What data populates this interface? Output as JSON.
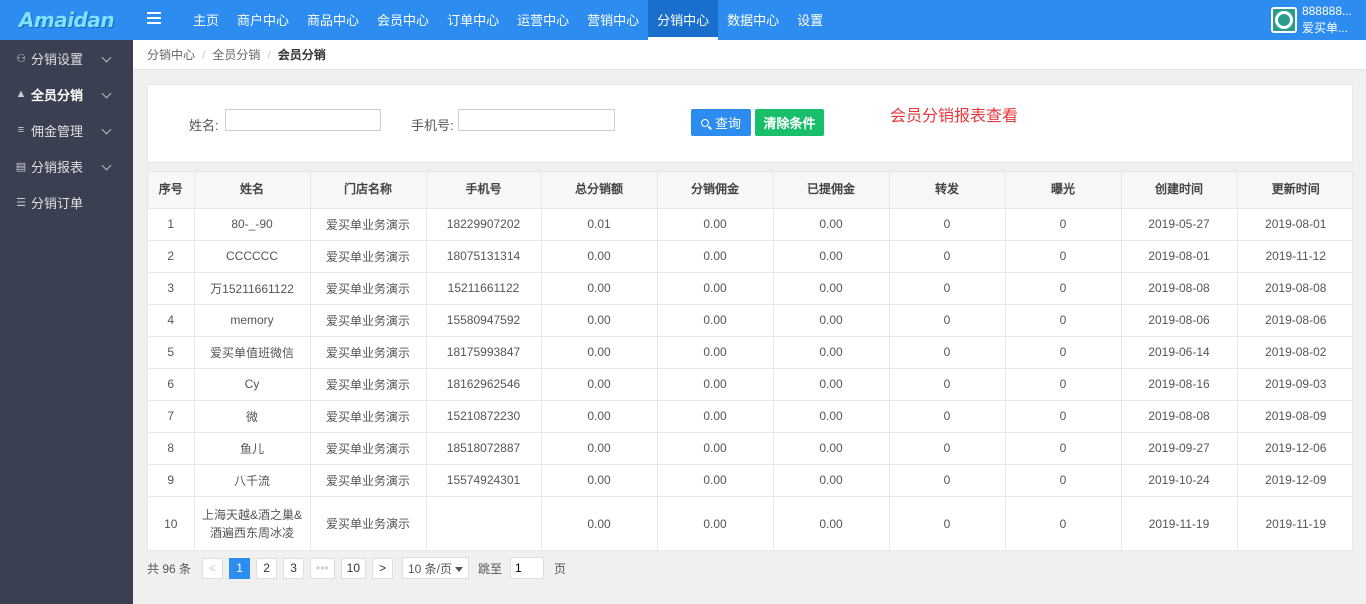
{
  "logo": "Amaidan",
  "nav": [
    "主页",
    "商户中心",
    "商品中心",
    "会员中心",
    "订单中心",
    "运营中心",
    "营销中心",
    "分销中心",
    "数据中心",
    "设置"
  ],
  "nav_active": 7,
  "user": {
    "line1": "888888...",
    "line2": "爱买单..."
  },
  "sidebar": [
    {
      "label": "分销设置",
      "icon": "users-icon",
      "caret": true
    },
    {
      "label": "全员分销",
      "icon": "user-icon",
      "caret": true,
      "active": true
    },
    {
      "label": "佣金管理",
      "icon": "database-icon",
      "caret": true
    },
    {
      "label": "分销报表",
      "icon": "report-icon",
      "caret": true
    },
    {
      "label": "分销订单",
      "icon": "list-icon",
      "caret": false
    }
  ],
  "breadcrumb": [
    "分销中心",
    "全员分销",
    "会员分销"
  ],
  "search": {
    "name_label": "姓名:",
    "name_value": "",
    "phone_label": "手机号:",
    "phone_value": "",
    "query_button": "查询",
    "clear_button": "清除条件",
    "report_title": "会员分销报表查看"
  },
  "table": {
    "headers": [
      "序号",
      "姓名",
      "门店名称",
      "手机号",
      "总分销额",
      "分销佣金",
      "已提佣金",
      "转发",
      "曝光",
      "创建时间",
      "更新时间"
    ],
    "rows": [
      [
        "1",
        "80-_-90",
        "爱买单业务演示",
        "18229907202",
        "0.01",
        "0.00",
        "0.00",
        "0",
        "0",
        "2019-05-27",
        "2019-08-01"
      ],
      [
        "2",
        "CCCCCC",
        "爱买单业务演示",
        "18075131314",
        "0.00",
        "0.00",
        "0.00",
        "0",
        "0",
        "2019-08-01",
        "2019-11-12"
      ],
      [
        "3",
        "万15211661122",
        "爱买单业务演示",
        "15211661122",
        "0.00",
        "0.00",
        "0.00",
        "0",
        "0",
        "2019-08-08",
        "2019-08-08"
      ],
      [
        "4",
        "memory",
        "爱买单业务演示",
        "15580947592",
        "0.00",
        "0.00",
        "0.00",
        "0",
        "0",
        "2019-08-06",
        "2019-08-06"
      ],
      [
        "5",
        "爱买单值班微信",
        "爱买单业务演示",
        "18175993847",
        "0.00",
        "0.00",
        "0.00",
        "0",
        "0",
        "2019-06-14",
        "2019-08-02"
      ],
      [
        "6",
        "Cy",
        "爱买单业务演示",
        "18162962546",
        "0.00",
        "0.00",
        "0.00",
        "0",
        "0",
        "2019-08-16",
        "2019-09-03"
      ],
      [
        "7",
        "微",
        "爱买单业务演示",
        "15210872230",
        "0.00",
        "0.00",
        "0.00",
        "0",
        "0",
        "2019-08-08",
        "2019-08-09"
      ],
      [
        "8",
        "鱼儿",
        "爱买单业务演示",
        "18518072887",
        "0.00",
        "0.00",
        "0.00",
        "0",
        "0",
        "2019-09-27",
        "2019-12-06"
      ],
      [
        "9",
        "八千流",
        "爱买单业务演示",
        "15574924301",
        "0.00",
        "0.00",
        "0.00",
        "0",
        "0",
        "2019-10-24",
        "2019-12-09"
      ],
      [
        "10",
        "上海天越&酒之巢&酒遍西东周冰凌",
        "爱买单业务演示",
        "",
        "0.00",
        "0.00",
        "0.00",
        "0",
        "0",
        "2019-11-19",
        "2019-11-19"
      ]
    ]
  },
  "pager": {
    "total_text": "共 96 条",
    "prev": "<",
    "pages": [
      "1",
      "2",
      "3",
      "•••",
      "10"
    ],
    "active_page": "1",
    "next": ">",
    "page_size": "10 条/页",
    "jump_label": "跳至",
    "jump_value": "1",
    "page_suffix": "页"
  }
}
